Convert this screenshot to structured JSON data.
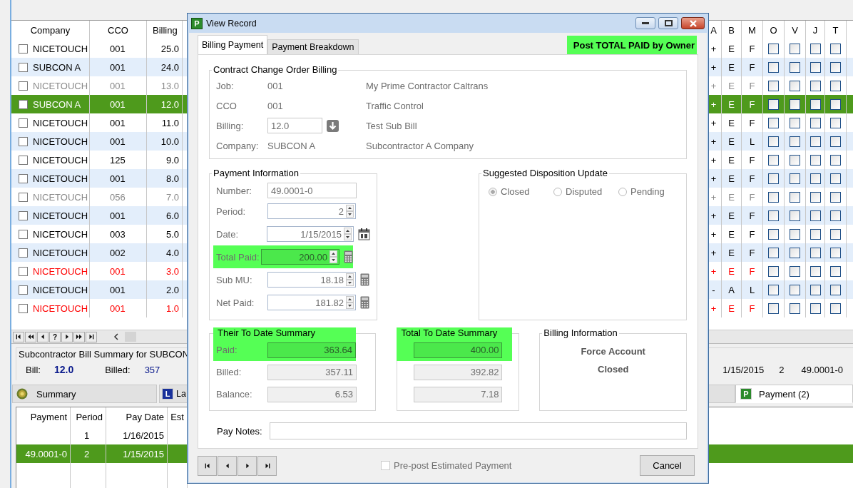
{
  "grid": {
    "columns_left": [
      "Company",
      "CCO",
      "Billing"
    ],
    "columns_right": [
      "A",
      "B",
      "M",
      "O",
      "V",
      "J",
      "T"
    ],
    "rows": [
      {
        "checked": false,
        "company": "NICETOUCH",
        "cco": "001",
        "billing": "25.0",
        "a": "+",
        "b": "E",
        "m": "F",
        "flags": [
          false,
          false,
          false,
          false
        ],
        "disabled": false,
        "alert": false,
        "selected": false
      },
      {
        "checked": false,
        "company": "SUBCON A",
        "cco": "001",
        "billing": "24.0",
        "a": "+",
        "b": "E",
        "m": "F",
        "flags": [
          false,
          false,
          false,
          false
        ],
        "disabled": false,
        "alert": false,
        "selected": false
      },
      {
        "checked": false,
        "company": "NICETOUCH",
        "cco": "001",
        "billing": "13.0",
        "a": "+",
        "b": "E",
        "m": "F",
        "flags": [
          false,
          false,
          false,
          false
        ],
        "disabled": true,
        "alert": false,
        "selected": false
      },
      {
        "checked": false,
        "company": "SUBCON A",
        "cco": "001",
        "billing": "12.0",
        "a": "+",
        "b": "E",
        "m": "F",
        "flags": [
          false,
          false,
          false,
          false
        ],
        "disabled": false,
        "alert": false,
        "selected": true
      },
      {
        "checked": false,
        "company": "NICETOUCH",
        "cco": "001",
        "billing": "11.0",
        "a": "+",
        "b": "E",
        "m": "F",
        "flags": [
          false,
          false,
          false,
          false
        ],
        "disabled": false,
        "alert": false,
        "selected": false
      },
      {
        "checked": false,
        "company": "NICETOUCH",
        "cco": "001",
        "billing": "10.0",
        "a": "+",
        "b": "E",
        "m": "L",
        "flags": [
          false,
          false,
          false,
          false
        ],
        "disabled": false,
        "alert": false,
        "selected": false
      },
      {
        "checked": false,
        "company": "NICETOUCH",
        "cco": "125",
        "billing": "9.0",
        "a": "+",
        "b": "E",
        "m": "F",
        "flags": [
          false,
          false,
          false,
          false
        ],
        "disabled": false,
        "alert": false,
        "selected": false
      },
      {
        "checked": false,
        "company": "NICETOUCH",
        "cco": "001",
        "billing": "8.0",
        "a": "+",
        "b": "E",
        "m": "F",
        "flags": [
          false,
          false,
          false,
          false
        ],
        "disabled": false,
        "alert": false,
        "selected": false
      },
      {
        "checked": false,
        "company": "NICETOUCH",
        "cco": "056",
        "billing": "7.0",
        "a": "+",
        "b": "E",
        "m": "F",
        "flags": [
          false,
          false,
          false,
          false
        ],
        "disabled": true,
        "alert": false,
        "selected": false
      },
      {
        "checked": false,
        "company": "NICETOUCH",
        "cco": "001",
        "billing": "6.0",
        "a": "+",
        "b": "E",
        "m": "F",
        "flags": [
          false,
          false,
          false,
          false
        ],
        "disabled": false,
        "alert": false,
        "selected": false
      },
      {
        "checked": false,
        "company": "NICETOUCH",
        "cco": "003",
        "billing": "5.0",
        "a": "+",
        "b": "E",
        "m": "F",
        "flags": [
          false,
          false,
          false,
          false
        ],
        "disabled": false,
        "alert": false,
        "selected": false
      },
      {
        "checked": false,
        "company": "NICETOUCH",
        "cco": "002",
        "billing": "4.0",
        "a": "+",
        "b": "E",
        "m": "F",
        "flags": [
          false,
          false,
          false,
          false
        ],
        "disabled": false,
        "alert": false,
        "selected": false
      },
      {
        "checked": false,
        "company": "NICETOUCH",
        "cco": "001",
        "billing": "3.0",
        "a": "+",
        "b": "E",
        "m": "F",
        "flags": [
          false,
          false,
          false,
          false
        ],
        "disabled": false,
        "alert": true,
        "selected": false
      },
      {
        "checked": false,
        "company": "NICETOUCH",
        "cco": "001",
        "billing": "2.0",
        "a": "-",
        "b": "A",
        "m": "L",
        "flags": [
          false,
          false,
          false,
          false
        ],
        "disabled": false,
        "alert": false,
        "selected": false
      },
      {
        "checked": false,
        "company": "NICETOUCH",
        "cco": "001",
        "billing": "1.0",
        "a": "+",
        "b": "E",
        "m": "F",
        "flags": [
          false,
          false,
          false,
          false
        ],
        "disabled": false,
        "alert": true,
        "selected": false
      }
    ]
  },
  "pager": [
    {
      "kind": "first"
    },
    {
      "kind": "fast-back"
    },
    {
      "kind": "back"
    },
    {
      "kind": "text",
      "label": "?"
    },
    {
      "kind": "next"
    },
    {
      "kind": "fast-next"
    },
    {
      "kind": "last"
    }
  ],
  "bill_summary": {
    "title": "Subcontractor Bill Summary for SUBCON",
    "bill_label": "Bill:",
    "bill": "12.0",
    "billed_label": "Billed:",
    "billed": "357",
    "date": "1/15/2015",
    "period": "2",
    "number": "49.0001-0"
  },
  "bottom_tabs": [
    {
      "label": "Summary",
      "selected": false
    },
    {
      "label": "La",
      "badge": "L",
      "selected": false
    },
    {
      "label": "Payment (2)",
      "badge": "P",
      "selected": true
    }
  ],
  "payments": {
    "columns": [
      "Payment",
      "Period",
      "Pay Date",
      "Est"
    ],
    "rows": [
      {
        "period": "1",
        "pay_date": "1/16/2015",
        "selected": false
      },
      {
        "payment": "49.0001-0",
        "period": "2",
        "pay_date": "1/15/2015",
        "selected": true
      }
    ]
  },
  "dialog": {
    "title": "View Record",
    "badge": "P",
    "tabs": [
      {
        "label": "Billing Payment",
        "selected": true
      },
      {
        "label": "Payment Breakdown",
        "selected": false
      }
    ],
    "action": {
      "label": "Post TOTAL PAID by Owner",
      "highlighted": true
    },
    "cco_billing": {
      "title": "Contract Change Order Billing",
      "rows": [
        {
          "kind": "text",
          "label": "Job:",
          "value": "001",
          "description": "My Prime Contractor Caltrans"
        },
        {
          "kind": "text",
          "label": "CCO",
          "value": "001",
          "description": "Traffic Control"
        },
        {
          "kind": "field",
          "label": "Billing:",
          "value": "12.0",
          "description": "Test Sub Bill"
        },
        {
          "kind": "text",
          "label": "Company:",
          "value": "SUBCON A",
          "description": "Subcontractor A Company"
        }
      ]
    },
    "payment_info": {
      "title": "Payment Information",
      "fields": [
        {
          "kind": "plain",
          "label": "Number:",
          "value": "49.0001-0",
          "highlighted": false
        },
        {
          "kind": "spin",
          "label": "Period:",
          "value": "2",
          "highlighted": false
        },
        {
          "kind": "date",
          "label": "Date:",
          "value": "1/15/2015",
          "highlighted": false
        },
        {
          "kind": "calc",
          "label": "Total Paid:",
          "value": "200.00",
          "highlighted": true
        },
        {
          "kind": "calc",
          "label": "Sub MU:",
          "value": "18.18",
          "highlighted": false
        },
        {
          "kind": "calc",
          "label": "Net Paid:",
          "value": "181.82",
          "highlighted": false
        }
      ]
    },
    "disposition": {
      "title": "Suggested Disposition Update",
      "disabled": true,
      "options": [
        {
          "label": "Closed",
          "selected": true
        },
        {
          "label": "Disputed",
          "selected": false
        },
        {
          "label": "Pending",
          "selected": false
        }
      ]
    },
    "summaries": [
      {
        "title": "Their To Date Summary",
        "highlighted": true,
        "rows": [
          {
            "label": "Paid:",
            "value": "363.64"
          },
          {
            "label": "Billed:",
            "value": "357.11"
          },
          {
            "label": "Balance:",
            "value": "6.53"
          }
        ]
      },
      {
        "title": "Total To Date Summary",
        "highlighted": true,
        "rows": [
          {
            "value": "400.00"
          },
          {
            "value": "392.82"
          },
          {
            "value": "7.18"
          }
        ]
      }
    ],
    "billing_info": {
      "title": "Billing Information",
      "lines": [
        "Force Account",
        "Closed"
      ]
    },
    "pay_notes": {
      "label": "Pay Notes:"
    },
    "nav": [
      {
        "kind": "first"
      },
      {
        "kind": "back"
      },
      {
        "kind": "next"
      },
      {
        "kind": "last"
      }
    ],
    "prepost": {
      "label": "Pre-post Estimated Payment",
      "checked": false,
      "disabled": true
    },
    "cancel": "Cancel"
  }
}
